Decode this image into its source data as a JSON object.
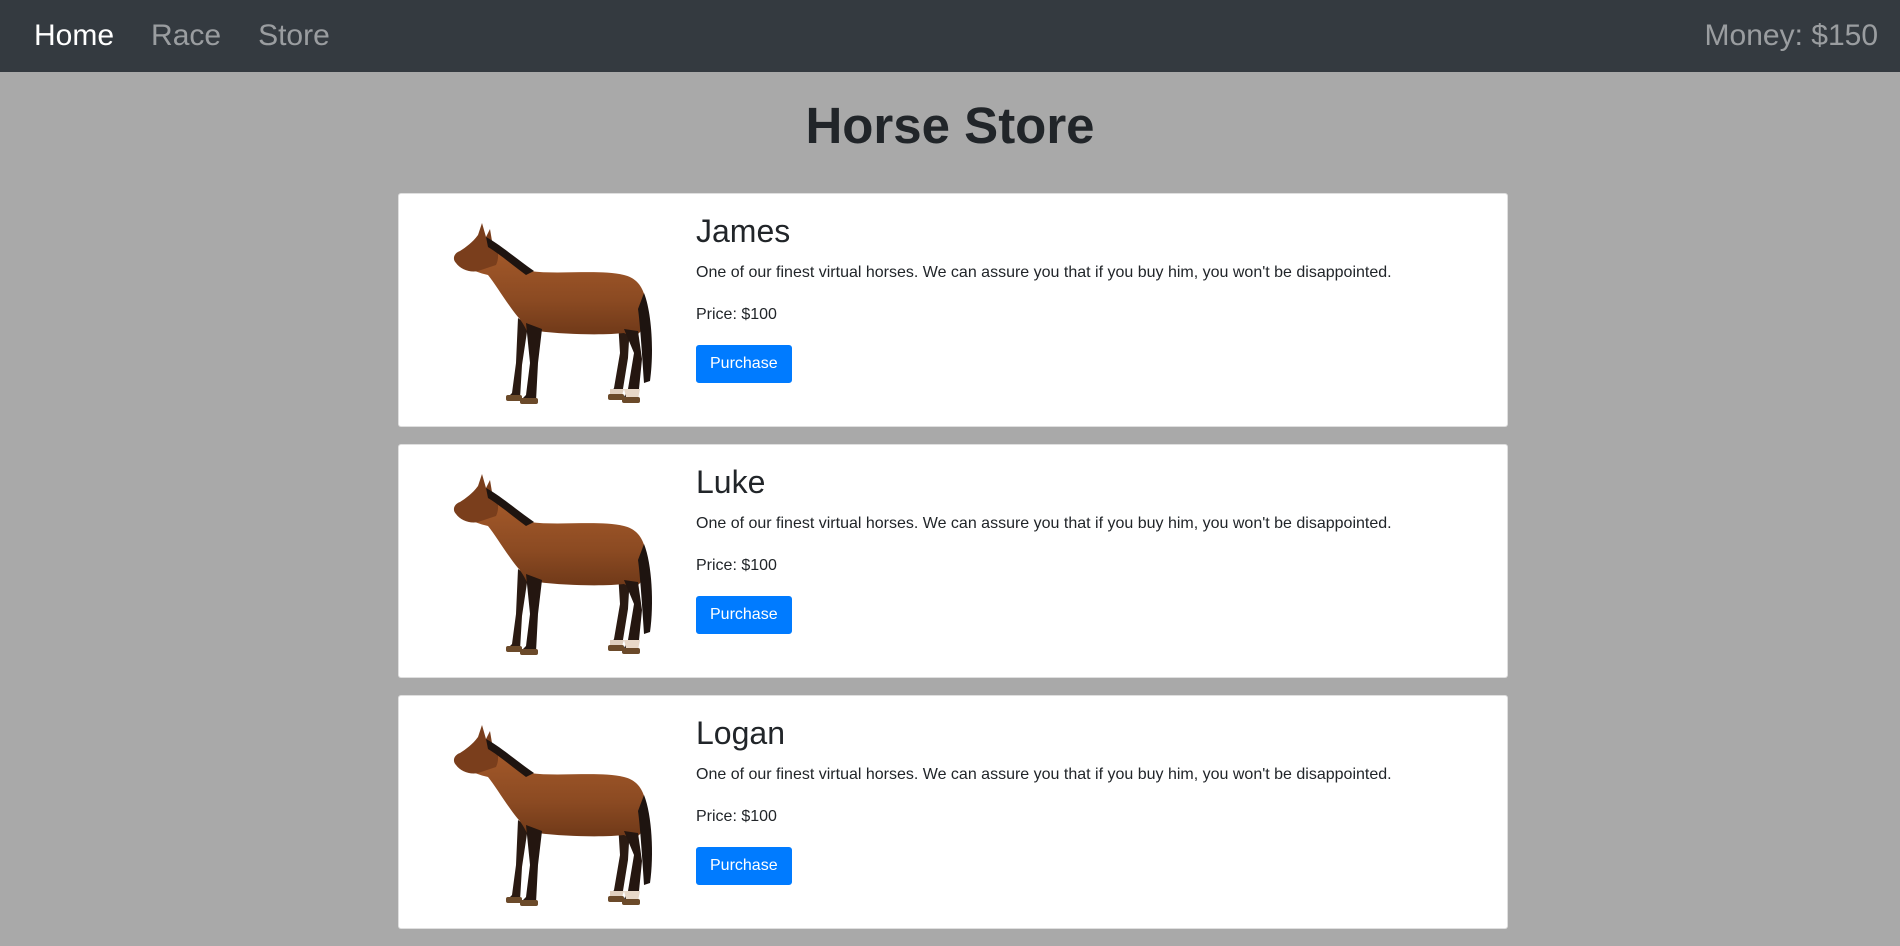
{
  "nav": {
    "links": [
      {
        "label": "Home",
        "active": true
      },
      {
        "label": "Race",
        "active": false
      },
      {
        "label": "Store",
        "active": false
      }
    ],
    "money": "Money: $150"
  },
  "page": {
    "title": "Horse Store"
  },
  "horses": [
    {
      "name": "James",
      "description": "One of our finest virtual horses. We can assure you that if you buy him, you won't be disappointed.",
      "price": "Price: $100",
      "button_label": "Purchase",
      "image": "bay-horse-image"
    },
    {
      "name": "Luke",
      "description": "One of our finest virtual horses. We can assure you that if you buy him, you won't be disappointed.",
      "price": "Price: $100",
      "button_label": "Purchase",
      "image": "bay-horse-image"
    },
    {
      "name": "Logan",
      "description": "One of our finest virtual horses. We can assure you that if you buy him, you won't be disappointed.",
      "price": "Price: $100",
      "button_label": "Purchase",
      "image": "bay-horse-image"
    }
  ],
  "colors": {
    "navbar": "#343a40",
    "background": "#a9a9a9",
    "button": "#007bff",
    "horse_coat": "#8b4a22",
    "horse_mane": "#1e1410"
  }
}
